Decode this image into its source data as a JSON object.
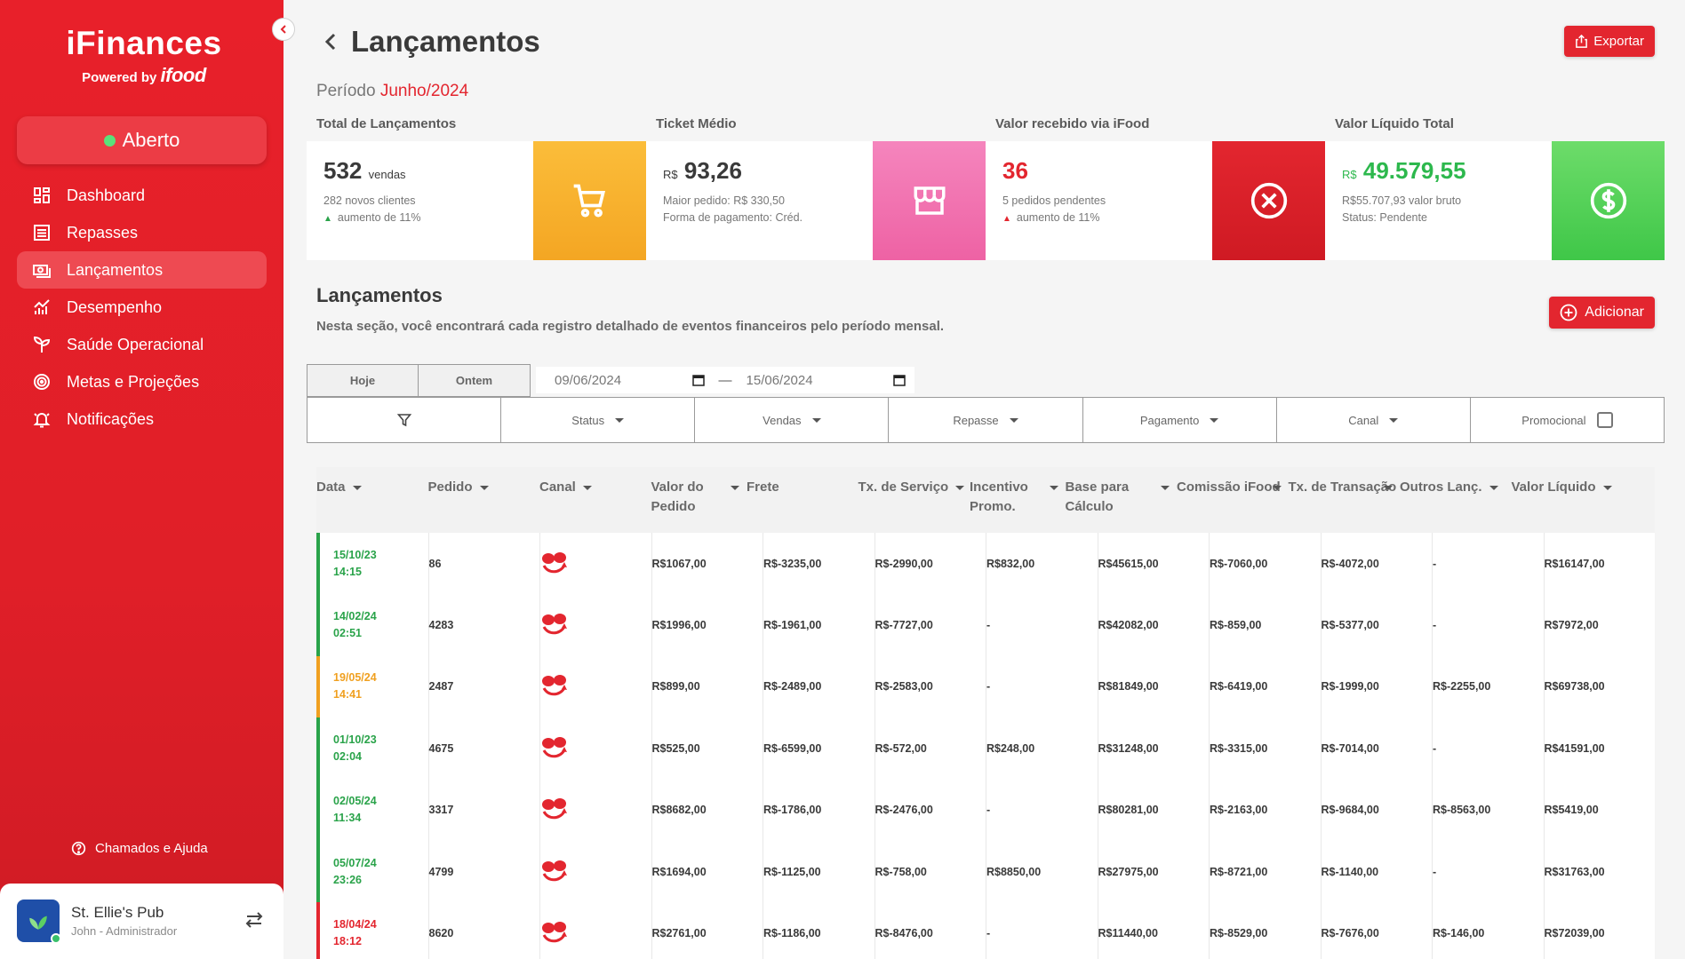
{
  "app": {
    "brand": "iFinances",
    "powered_by": "Powered by",
    "powered_brand": "ifood",
    "status": "Aberto"
  },
  "sidebar": {
    "items": [
      {
        "label": "Dashboard",
        "icon": "dashboard-icon"
      },
      {
        "label": "Repasses",
        "icon": "list-icon"
      },
      {
        "label": "Lançamentos",
        "icon": "money-icon",
        "active": true
      },
      {
        "label": "Desempenho",
        "icon": "chart-icon"
      },
      {
        "label": "Saúde Operacional",
        "icon": "plant-icon"
      },
      {
        "label": "Metas e Projeções",
        "icon": "target-icon"
      },
      {
        "label": "Notificações",
        "icon": "bell-icon"
      }
    ],
    "help": "Chamados e Ajuda"
  },
  "user": {
    "store": "St. Ellie's Pub",
    "role": "John - Administrador"
  },
  "header": {
    "title": "Lançamentos",
    "export": "Exportar",
    "period_label": "Período",
    "period_value": "Junho/2024"
  },
  "stats": [
    {
      "label": "Total de Lançamentos",
      "main": "532",
      "unit": "vendas",
      "sub1": "282 novos clientes",
      "sub2": "aumento de 11%",
      "color": "#f7ac2a"
    },
    {
      "label": "Ticket Médio",
      "prefix": "R$",
      "main": "93,26",
      "sub1": "Maior pedido: R$ 330,50",
      "sub2": "Forma de pagamento: Créd.",
      "color": "#f06fae"
    },
    {
      "label": "Valor recebido via iFood",
      "main": "36",
      "sub1": "5 pedidos pendentes",
      "sub2": "aumento de 11%",
      "color": "#d91e26"
    },
    {
      "label": "Valor Líquido Total",
      "prefix": "R$",
      "main": "49.579,55",
      "sub1": "R$55.707,93 valor bruto",
      "sub2": "Status: Pendente",
      "color": "#4ccf52"
    }
  ],
  "section": {
    "title": "Lançamentos",
    "description": "Nesta seção, você encontrará cada registro detalhado de eventos financeiros pelo período mensal.",
    "add": "Adicionar"
  },
  "filters": {
    "today": "Hoje",
    "yesterday": "Ontem",
    "date_from": "09/06/2024",
    "date_to": "15/06/2024",
    "status": "Status",
    "sales": "Vendas",
    "transfer": "Repasse",
    "payment": "Pagamento",
    "channel": "Canal",
    "promo": "Promocional"
  },
  "table": {
    "headers": [
      "Data",
      "Pedido",
      "Canal",
      "Valor do Pedido",
      "Frete",
      "Tx. de Serviço",
      "Incentivo Promo.",
      "Base para Cálculo",
      "Comissão iFood",
      "Tx. de Transação",
      "Outros Lanç.",
      "Valor Líquido"
    ],
    "rows": [
      {
        "date": "15/10/23",
        "time": "14:15",
        "status": "ok",
        "cells": [
          "86",
          "",
          "R$1067,00",
          "R$-3235,00",
          "R$-2990,00",
          "R$832,00",
          "R$45615,00",
          "R$-7060,00",
          "R$-4072,00",
          "-",
          "R$16147,00"
        ]
      },
      {
        "date": "14/02/24",
        "time": "02:51",
        "status": "ok",
        "cells": [
          "4283",
          "",
          "R$1996,00",
          "R$-1961,00",
          "R$-7727,00",
          "-",
          "R$42082,00",
          "R$-859,00",
          "R$-5377,00",
          "-",
          "R$7972,00"
        ]
      },
      {
        "date": "19/05/24",
        "time": "14:41",
        "status": "warn",
        "cells": [
          "2487",
          "",
          "R$899,00",
          "R$-2489,00",
          "R$-2583,00",
          "-",
          "R$81849,00",
          "R$-6419,00",
          "R$-1999,00",
          "R$-2255,00",
          "R$69738,00"
        ]
      },
      {
        "date": "01/10/23",
        "time": "02:04",
        "status": "ok",
        "cells": [
          "4675",
          "",
          "R$525,00",
          "R$-6599,00",
          "R$-572,00",
          "R$248,00",
          "R$31248,00",
          "R$-3315,00",
          "R$-7014,00",
          "-",
          "R$41591,00"
        ]
      },
      {
        "date": "02/05/24",
        "time": "11:34",
        "status": "ok",
        "cells": [
          "3317",
          "",
          "R$8682,00",
          "R$-1786,00",
          "R$-2476,00",
          "-",
          "R$80281,00",
          "R$-2163,00",
          "R$-9684,00",
          "R$-8563,00",
          "R$5419,00"
        ]
      },
      {
        "date": "05/07/24",
        "time": "23:26",
        "status": "ok",
        "cells": [
          "4799",
          "",
          "R$1694,00",
          "R$-1125,00",
          "R$-758,00",
          "R$8850,00",
          "R$27975,00",
          "R$-8721,00",
          "R$-1140,00",
          "-",
          "R$31763,00"
        ]
      },
      {
        "date": "18/04/24",
        "time": "18:12",
        "status": "err",
        "cells": [
          "8620",
          "",
          "R$2761,00",
          "R$-1186,00",
          "R$-8476,00",
          "-",
          "R$11440,00",
          "R$-8529,00",
          "R$-7676,00",
          "R$-146,00",
          "R$72039,00"
        ]
      }
    ]
  }
}
